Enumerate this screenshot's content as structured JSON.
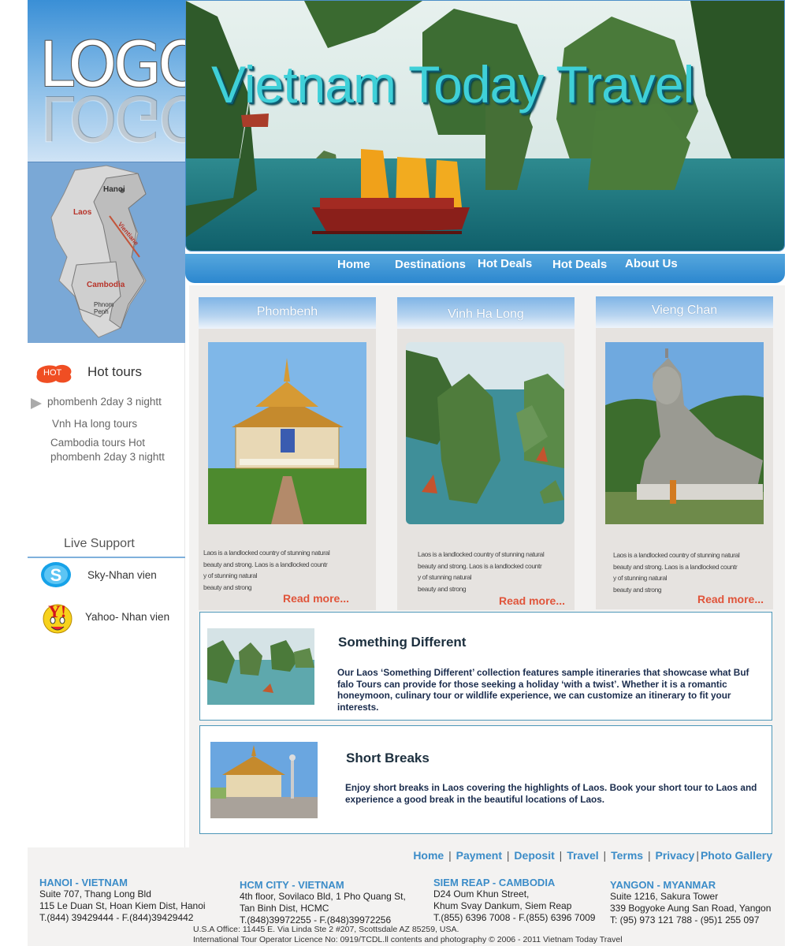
{
  "logo": {
    "text": "LOGO"
  },
  "map": {
    "labels": [
      "Hanoi",
      "Laos",
      "Vientiane",
      "Cambodia",
      "Phnom Penh"
    ],
    "colors": {
      "land": "#c9c9c9",
      "water": "#7aa8d6"
    }
  },
  "banner": {
    "title": "Vietnam Today Travel"
  },
  "nav": {
    "items": [
      "Home",
      "Destinations",
      "Hot Deals",
      "Hot Deals",
      "About Us"
    ]
  },
  "sidebar": {
    "hot_badge": "HOT",
    "hot_title": "Hot tours",
    "tours": [
      "phombenh 2day 3 nightt",
      "Vnh Ha long tours",
      "Cambodia tours Hot",
      "phombenh 2day 3 nightt"
    ],
    "live_support_title": "Live Support",
    "support": [
      {
        "label": "Sky-Nhan vien",
        "icon": "skype-icon"
      },
      {
        "label": "Yahoo- Nhan vien",
        "icon": "yahoo-icon"
      }
    ]
  },
  "cards": [
    {
      "title": "Phombenh",
      "text": [
        "Laos is a landlocked country of stunning natural",
        " beauty and strong. Laos is a landlocked countr",
        "y of stunning natural",
        " beauty and strong"
      ],
      "read_more": "Read more..."
    },
    {
      "title": "Vinh Ha Long",
      "text": [
        "Laos is a landlocked country of stunning natural",
        " beauty and strong. Laos is a landlocked countr",
        "y of stunning natural",
        " beauty and strong"
      ],
      "read_more": "Read more..."
    },
    {
      "title": "Vieng Chan",
      "text": [
        "Laos is a landlocked country of stunning natural",
        " beauty and strong. Laos is a landlocked countr",
        "y of stunning natural",
        " beauty and strong"
      ],
      "read_more": "Read more..."
    }
  ],
  "features": [
    {
      "title": "Something Different",
      "text": [
        "Our Laos ‘Something Different’ collection features sample itineraries that showcase what Buf",
        "falo Tours can provide for those seeking a holiday ‘with a twist’. Whether it is a romantic",
        " honeymoon, culinary tour or wildlife experience, we can customize an itinerary to fit your",
        "interests."
      ]
    },
    {
      "title": "Short Breaks",
      "text": [
        "Enjoy short breaks in Laos covering the highlights of Laos. Book your short tour to Laos and",
        "experience a good break in the beautiful locations of Laos."
      ]
    }
  ],
  "footer": {
    "links": [
      "Home",
      "Payment",
      "Deposit",
      "Travel",
      "Terms",
      "Privacy",
      "Photo Gallery"
    ],
    "offices": [
      {
        "name": "HANOI - VIETNAM",
        "lines": [
          "Suite 707, Thang Long Bld",
          "115 Le Duan St, Hoan Kiem Dist, Hanoi",
          "T.(844) 39429444 - F.(844)39429442"
        ]
      },
      {
        "name": "HCM CITY - VIETNAM",
        "lines": [
          "4th floor, Sovilaco Bld, 1 Pho Quang St,",
          "Tan Binh Dist, HCMC",
          "T.(848)39972255 - F.(848)39972256"
        ]
      },
      {
        "name": "SIEM REAP - CAMBODIA",
        "lines": [
          "D24 Oum Khun Street,",
          "Khum Svay Dankum, Siem Reap",
          "T.(855) 6396 7008 - F.(855) 6396 7009"
        ]
      },
      {
        "name": "YANGON - MYANMAR",
        "lines": [
          "Suite 1216, Sakura Tower",
          "339 Bogyoke Aung San Road, Yangon",
          "T: (95) 973 121 788 - (95)1 255 097"
        ]
      }
    ],
    "legal": [
      "U.S.A Office: 11445 E. Via Linda Ste 2 #207, Scottsdale AZ 85259, USA.",
      "International Tour Operator Licence No: 0919/TCDL.ll contents and photography © 2006 - 2011 Vietnam Today Travel"
    ]
  },
  "colors": {
    "accent": "#3b8cc8",
    "read_more": "#e0543a",
    "nav": "#2c87cf",
    "banner_title": "#3fd0d8"
  }
}
